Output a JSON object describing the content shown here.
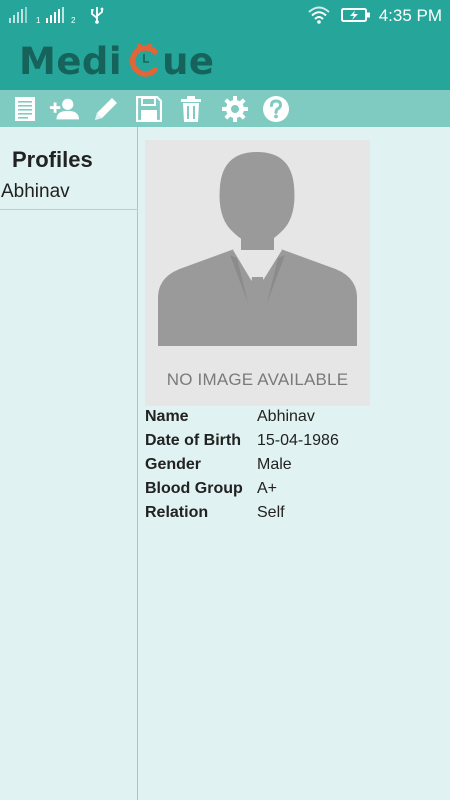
{
  "status_bar": {
    "sim1_label": "1",
    "sim2_label": "2",
    "time": "4:35 PM"
  },
  "app": {
    "logo_left": "Medi",
    "logo_right": "ue"
  },
  "toolbar": {
    "icons": [
      "document-icon",
      "add-person-icon",
      "edit-pencil-icon",
      "save-icon",
      "delete-trash-icon",
      "settings-gear-icon",
      "help-icon"
    ]
  },
  "sidebar": {
    "title": "Profiles",
    "profiles": [
      {
        "name": "Abhinav"
      }
    ]
  },
  "profile": {
    "image_caption": "NO IMAGE AVAILABLE",
    "fields": [
      {
        "label": "Name",
        "value": "Abhinav"
      },
      {
        "label": "Date of Birth",
        "value": "15-04-1986"
      },
      {
        "label": "Gender",
        "value": "Male"
      },
      {
        "label": "Blood Group",
        "value": "A+"
      },
      {
        "label": "Relation",
        "value": "Self"
      }
    ]
  },
  "colors": {
    "primary": "#26a69a",
    "toolbar": "#7fcbc2",
    "background": "#e0f2f1",
    "logo_text": "#16635b",
    "logo_accent": "#e0653a"
  }
}
